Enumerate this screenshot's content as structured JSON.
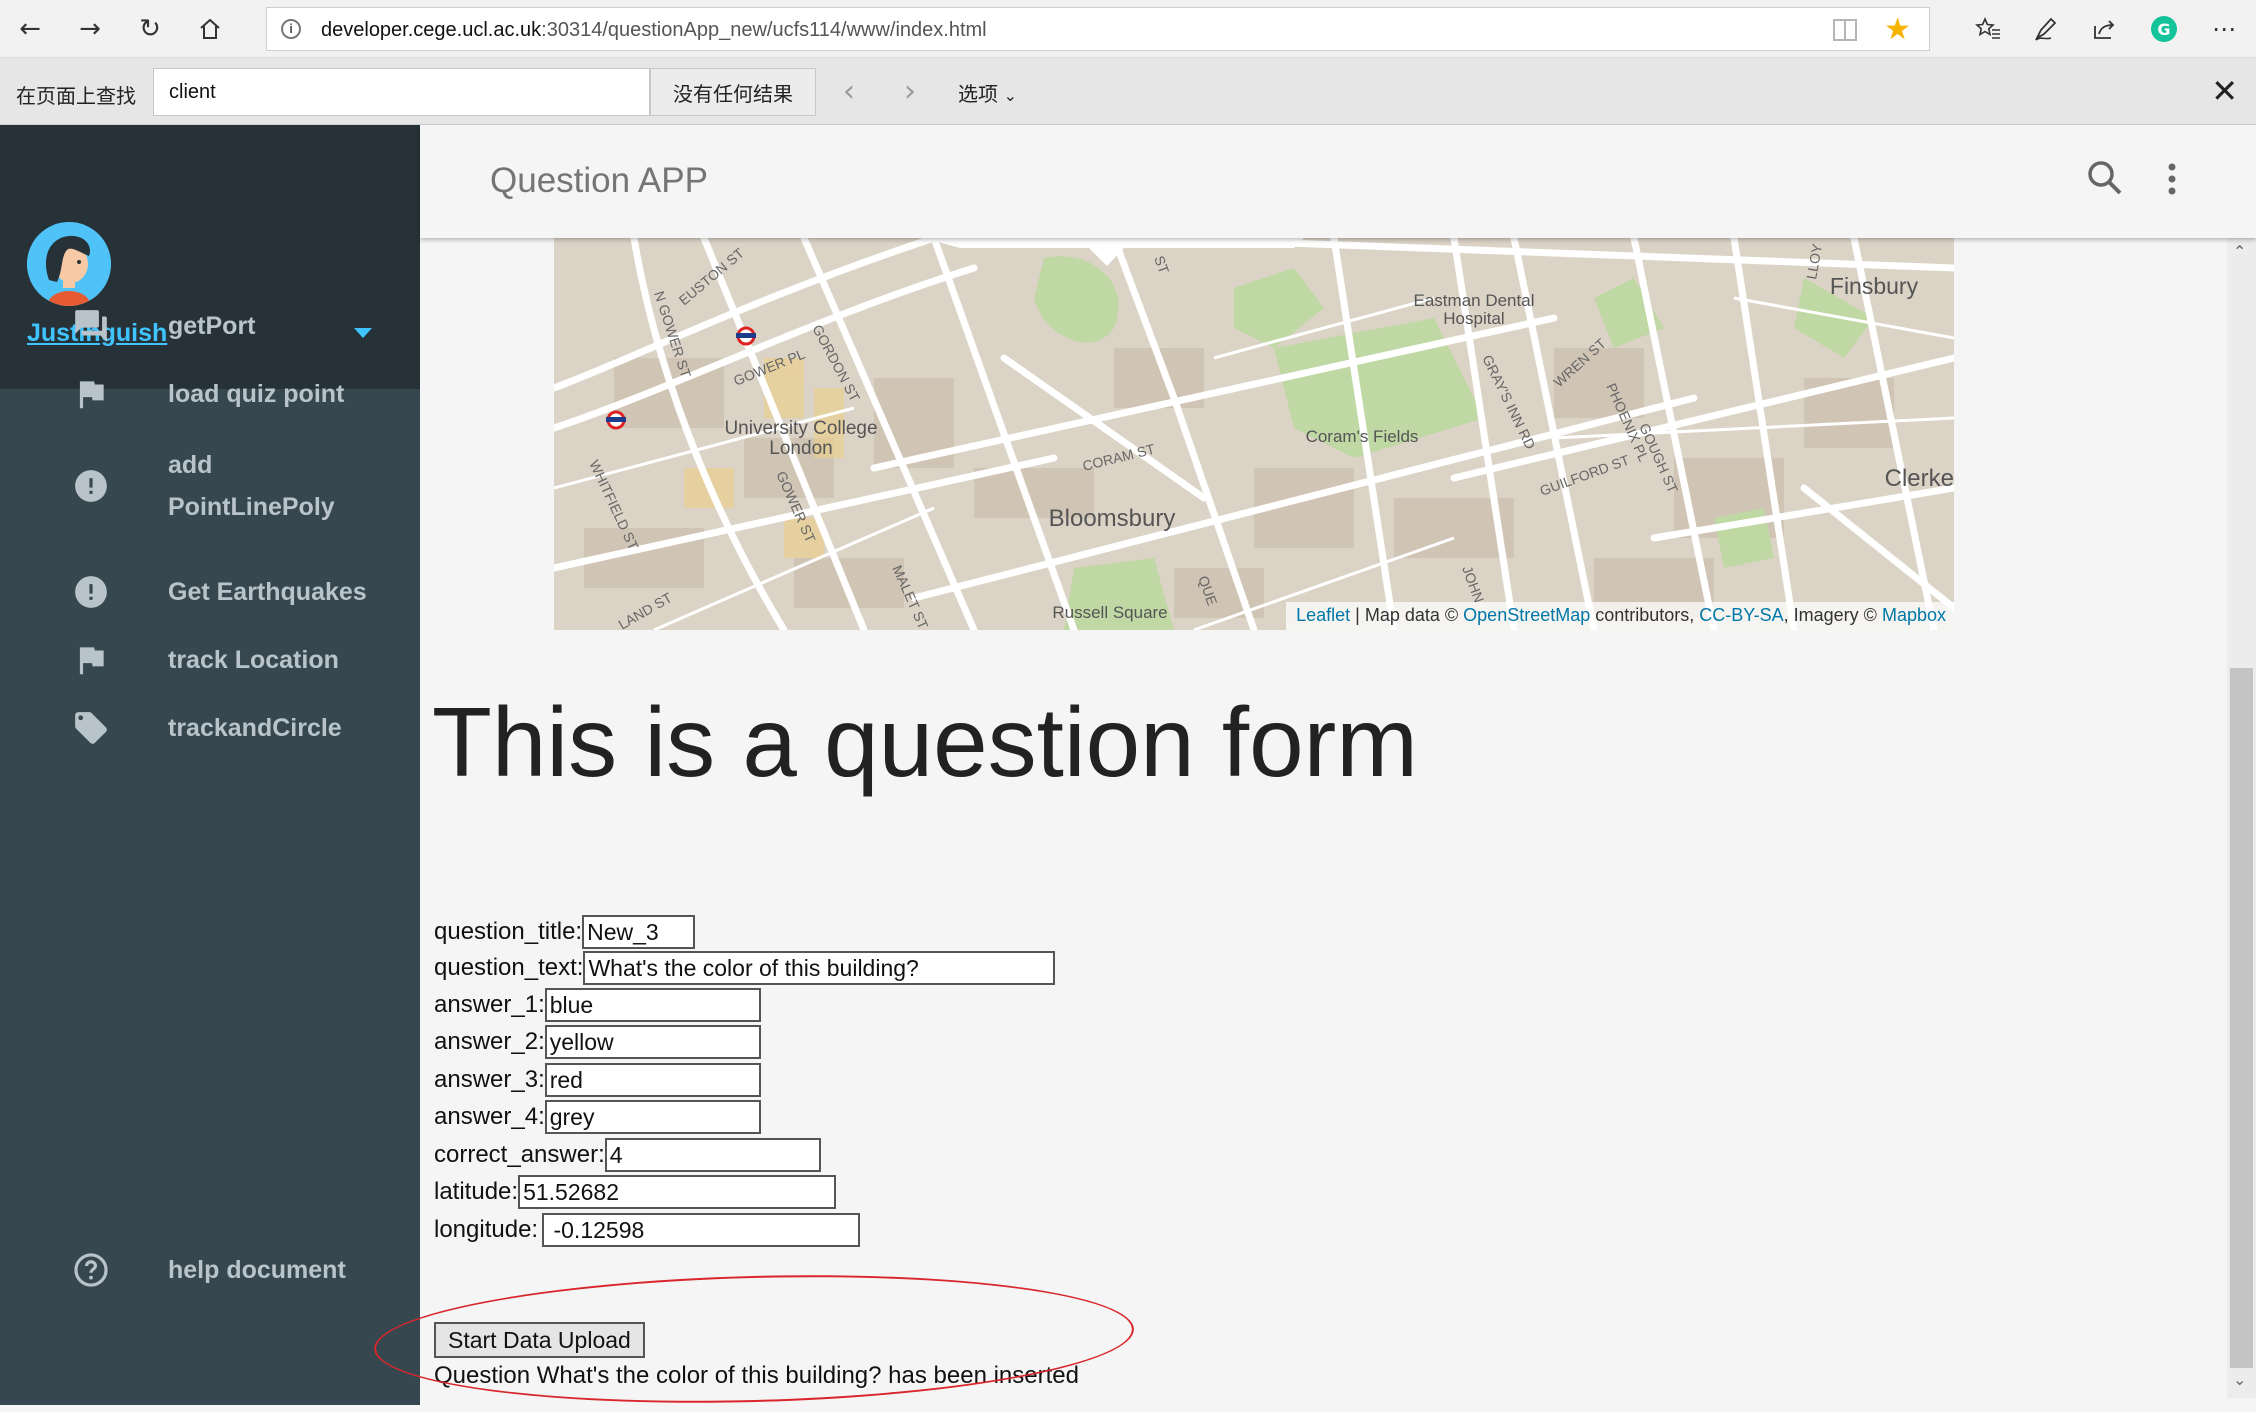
{
  "browser": {
    "url_host": "developer.cege.ucl.ac.uk",
    "url_rest": ":30314/questionApp_new/ucfs114/www/index.html",
    "icons": [
      "back-icon",
      "forward-icon",
      "refresh-icon",
      "home-icon",
      "favorites-icon",
      "pen-icon",
      "share-icon",
      "grammarly-icon",
      "more-icon"
    ]
  },
  "find_bar": {
    "label": "在页面上查找",
    "query": "client",
    "result": "没有任何结果",
    "options_label": "选项"
  },
  "sidebar": {
    "username": "Justinguish",
    "items": [
      {
        "label": "getPort",
        "icon": "forum-icon"
      },
      {
        "label": "load quiz point",
        "icon": "flag-icon"
      },
      {
        "label_line1": "add",
        "label_line2": "PointLinePoly",
        "icon": "alert-circle-icon"
      },
      {
        "label": "Get Earthquakes",
        "icon": "alert-circle-icon"
      },
      {
        "label": "track Location",
        "icon": "flag-icon"
      },
      {
        "label": "trackandCircle",
        "icon": "tag-icon"
      },
      {
        "label": "help document",
        "icon": "help-circle-icon"
      }
    ]
  },
  "app_bar": {
    "title": "Question APP"
  },
  "map": {
    "labels": {
      "finsbury": "Finsbury",
      "eastman_1": "Eastman Dental",
      "eastman_2": "Hospital",
      "ucl_1": "University College",
      "ucl_2": "London",
      "corams_fields": "Coram's Fields",
      "bloomsbury": "Bloomsbury",
      "clerke": "Clerke",
      "russell_square": "Russell Square",
      "gower_st": "GOWER ST",
      "gower_pl": "GOWER PL",
      "euston_st": "EUSTON ST",
      "gordon_st": "GORDON ST",
      "coram_st": "CORAM ST",
      "guilford_st": "GUILFORD ST",
      "grays_inn_rd": "GRAY'S INN RD",
      "wren_st": "WREN ST",
      "phoenix_pl": "PHOENIX PL",
      "gough_st": "GOUGH ST",
      "whitfield_st": "WHITFIELD ST",
      "malet_st": "MALET ST",
      "n_gower_st": "N GOWER ST",
      "land_st": "LAND ST",
      "lloyd": "LLOY",
      "st": "ST",
      "que": "QUE",
      "john": "JOHN"
    },
    "attribution": {
      "leaflet": "Leaflet",
      "sep1": " | Map data © ",
      "osm": "OpenStreetMap",
      "sep2": " contributors, ",
      "license": "CC-BY-SA",
      "sep3": ", Imagery © ",
      "mapbox": "Mapbox"
    }
  },
  "form": {
    "heading": "This is a question form",
    "fields": {
      "question_title": {
        "label": "question_title:",
        "value": "New_3"
      },
      "question_text": {
        "label": "question_text:",
        "value": "What's the color of this building?"
      },
      "answer_1": {
        "label": "answer_1:",
        "value": "blue"
      },
      "answer_2": {
        "label": "answer_2:",
        "value": "yellow"
      },
      "answer_3": {
        "label": "answer_3:",
        "value": "red"
      },
      "answer_4": {
        "label": "answer_4:",
        "value": "grey"
      },
      "correct_answer": {
        "label": "correct_answer:",
        "value": "4"
      },
      "latitude": {
        "label": "latitude:",
        "value": "51.52682"
      },
      "longitude": {
        "label": "longitude:",
        "value": " -0.12598"
      }
    },
    "upload_button": "Start Data Upload",
    "status": "Question What's the color of this building? has been inserted"
  },
  "colors": {
    "sidebar_bg": "#37474f",
    "sidebar_header_bg": "#263238",
    "accent": "#40c4ff",
    "annotation_red": "#d9262c"
  }
}
